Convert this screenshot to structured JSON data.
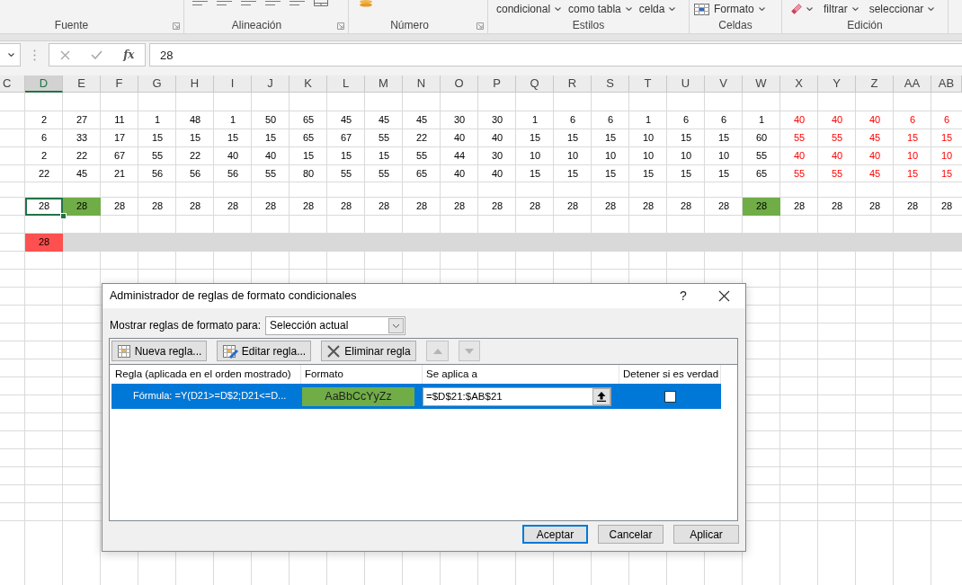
{
  "ribbon": {
    "groups": [
      {
        "kind": "font",
        "label": "Fuente"
      },
      {
        "kind": "alignment",
        "label": "Alineación"
      },
      {
        "kind": "number",
        "label": "Número"
      },
      {
        "kind": "styles",
        "label": "Estilos",
        "items": [
          {
            "label": "condicional"
          },
          {
            "label": "como tabla"
          },
          {
            "label": "celda"
          }
        ]
      },
      {
        "kind": "cells",
        "label": "Celdas",
        "items": [
          {
            "label": "Formato"
          }
        ]
      },
      {
        "kind": "editing",
        "label": "Edición",
        "items": [
          {
            "label": "filtrar"
          },
          {
            "label": "seleccionar"
          }
        ]
      }
    ]
  },
  "formula_bar": {
    "function_label": "fx",
    "value": "28"
  },
  "sheet": {
    "columns": [
      {
        "label": "C",
        "selected": false
      },
      {
        "label": "D",
        "selected": true
      },
      {
        "label": "E",
        "selected": false
      },
      {
        "label": "F",
        "selected": false
      },
      {
        "label": "G",
        "selected": false
      },
      {
        "label": "H",
        "selected": false
      },
      {
        "label": "I",
        "selected": false
      },
      {
        "label": "J",
        "selected": false
      },
      {
        "label": "K",
        "selected": false
      },
      {
        "label": "L",
        "selected": false
      },
      {
        "label": "M",
        "selected": false
      },
      {
        "label": "N",
        "selected": false
      },
      {
        "label": "O",
        "selected": false
      },
      {
        "label": "P",
        "selected": false
      },
      {
        "label": "Q",
        "selected": false
      },
      {
        "label": "R",
        "selected": false
      },
      {
        "label": "S",
        "selected": false
      },
      {
        "label": "T",
        "selected": false
      },
      {
        "label": "U",
        "selected": false
      },
      {
        "label": "V",
        "selected": false
      },
      {
        "label": "W",
        "selected": false
      },
      {
        "label": "X",
        "selected": false
      },
      {
        "label": "Y",
        "selected": false
      },
      {
        "label": "Z",
        "selected": false
      },
      {
        "label": "AA",
        "selected": false
      },
      {
        "label": "AB",
        "selected": false
      }
    ],
    "data_rows": [
      [
        {
          "value": "2",
          "flagged": false
        },
        {
          "value": "27",
          "flagged": false
        },
        {
          "value": "11",
          "flagged": false
        },
        {
          "value": "1",
          "flagged": false
        },
        {
          "value": "48",
          "flagged": false
        },
        {
          "value": "1",
          "flagged": false
        },
        {
          "value": "50",
          "flagged": false
        },
        {
          "value": "65",
          "flagged": false
        },
        {
          "value": "45",
          "flagged": false
        },
        {
          "value": "45",
          "flagged": false
        },
        {
          "value": "45",
          "flagged": false
        },
        {
          "value": "30",
          "flagged": false
        },
        {
          "value": "30",
          "flagged": false
        },
        {
          "value": "1",
          "flagged": false
        },
        {
          "value": "6",
          "flagged": false
        },
        {
          "value": "6",
          "flagged": false
        },
        {
          "value": "1",
          "flagged": false
        },
        {
          "value": "6",
          "flagged": false
        },
        {
          "value": "6",
          "flagged": false
        },
        {
          "value": "1",
          "flagged": false
        },
        {
          "value": "40",
          "flagged": true
        },
        {
          "value": "40",
          "flagged": true
        },
        {
          "value": "40",
          "flagged": true
        },
        {
          "value": "6",
          "flagged": true
        },
        {
          "value": "6",
          "flagged": true
        }
      ],
      [
        {
          "value": "6",
          "flagged": false
        },
        {
          "value": "33",
          "flagged": false
        },
        {
          "value": "17",
          "flagged": false
        },
        {
          "value": "15",
          "flagged": false
        },
        {
          "value": "15",
          "flagged": false
        },
        {
          "value": "15",
          "flagged": false
        },
        {
          "value": "15",
          "flagged": false
        },
        {
          "value": "65",
          "flagged": false
        },
        {
          "value": "67",
          "flagged": false
        },
        {
          "value": "55",
          "flagged": false
        },
        {
          "value": "22",
          "flagged": false
        },
        {
          "value": "40",
          "flagged": false
        },
        {
          "value": "40",
          "flagged": false
        },
        {
          "value": "15",
          "flagged": false
        },
        {
          "value": "15",
          "flagged": false
        },
        {
          "value": "15",
          "flagged": false
        },
        {
          "value": "10",
          "flagged": false
        },
        {
          "value": "15",
          "flagged": false
        },
        {
          "value": "15",
          "flagged": false
        },
        {
          "value": "60",
          "flagged": false
        },
        {
          "value": "55",
          "flagged": true
        },
        {
          "value": "55",
          "flagged": true
        },
        {
          "value": "45",
          "flagged": true
        },
        {
          "value": "15",
          "flagged": true
        },
        {
          "value": "15",
          "flagged": true
        }
      ],
      [
        {
          "value": "2",
          "flagged": false
        },
        {
          "value": "22",
          "flagged": false
        },
        {
          "value": "67",
          "flagged": false
        },
        {
          "value": "55",
          "flagged": false
        },
        {
          "value": "22",
          "flagged": false
        },
        {
          "value": "40",
          "flagged": false
        },
        {
          "value": "40",
          "flagged": false
        },
        {
          "value": "15",
          "flagged": false
        },
        {
          "value": "15",
          "flagged": false
        },
        {
          "value": "15",
          "flagged": false
        },
        {
          "value": "55",
          "flagged": false
        },
        {
          "value": "44",
          "flagged": false
        },
        {
          "value": "30",
          "flagged": false
        },
        {
          "value": "10",
          "flagged": false
        },
        {
          "value": "10",
          "flagged": false
        },
        {
          "value": "10",
          "flagged": false
        },
        {
          "value": "10",
          "flagged": false
        },
        {
          "value": "10",
          "flagged": false
        },
        {
          "value": "10",
          "flagged": false
        },
        {
          "value": "55",
          "flagged": false
        },
        {
          "value": "40",
          "flagged": true
        },
        {
          "value": "40",
          "flagged": true
        },
        {
          "value": "40",
          "flagged": true
        },
        {
          "value": "10",
          "flagged": true
        },
        {
          "value": "10",
          "flagged": true
        }
      ],
      [
        {
          "value": "22",
          "flagged": false
        },
        {
          "value": "45",
          "flagged": false
        },
        {
          "value": "21",
          "flagged": false
        },
        {
          "value": "56",
          "flagged": false
        },
        {
          "value": "56",
          "flagged": false
        },
        {
          "value": "56",
          "flagged": false
        },
        {
          "value": "55",
          "flagged": false
        },
        {
          "value": "80",
          "flagged": false
        },
        {
          "value": "55",
          "flagged": false
        },
        {
          "value": "55",
          "flagged": false
        },
        {
          "value": "65",
          "flagged": false
        },
        {
          "value": "40",
          "flagged": false
        },
        {
          "value": "40",
          "flagged": false
        },
        {
          "value": "15",
          "flagged": false
        },
        {
          "value": "15",
          "flagged": false
        },
        {
          "value": "15",
          "flagged": false
        },
        {
          "value": "15",
          "flagged": false
        },
        {
          "value": "15",
          "flagged": false
        },
        {
          "value": "15",
          "flagged": false
        },
        {
          "value": "65",
          "flagged": false
        },
        {
          "value": "55",
          "flagged": true
        },
        {
          "value": "55",
          "flagged": true
        },
        {
          "value": "45",
          "flagged": true
        },
        {
          "value": "15",
          "flagged": true
        },
        {
          "value": "15",
          "flagged": true
        }
      ]
    ],
    "check_row": [
      {
        "value": "28",
        "selected": true,
        "highlighted": false
      },
      {
        "value": "28",
        "selected": false,
        "highlighted": true
      },
      {
        "value": "28",
        "selected": false,
        "highlighted": false
      },
      {
        "value": "28",
        "selected": false,
        "highlighted": false
      },
      {
        "value": "28",
        "selected": false,
        "highlighted": false
      },
      {
        "value": "28",
        "selected": false,
        "highlighted": false
      },
      {
        "value": "28",
        "selected": false,
        "highlighted": false
      },
      {
        "value": "28",
        "selected": false,
        "highlighted": false
      },
      {
        "value": "28",
        "selected": false,
        "highlighted": false
      },
      {
        "value": "28",
        "selected": false,
        "highlighted": false
      },
      {
        "value": "28",
        "selected": false,
        "highlighted": false
      },
      {
        "value": "28",
        "selected": false,
        "highlighted": false
      },
      {
        "value": "28",
        "selected": false,
        "highlighted": false
      },
      {
        "value": "28",
        "selected": false,
        "highlighted": false
      },
      {
        "value": "28",
        "selected": false,
        "highlighted": false
      },
      {
        "value": "28",
        "selected": false,
        "highlighted": false
      },
      {
        "value": "28",
        "selected": false,
        "highlighted": false
      },
      {
        "value": "28",
        "selected": false,
        "highlighted": false
      },
      {
        "value": "28",
        "selected": false,
        "highlighted": false
      },
      {
        "value": "28",
        "selected": false,
        "highlighted": true
      },
      {
        "value": "28",
        "selected": false,
        "highlighted": false
      },
      {
        "value": "28",
        "selected": false,
        "highlighted": false
      },
      {
        "value": "28",
        "selected": false,
        "highlighted": false
      },
      {
        "value": "28",
        "selected": false,
        "highlighted": false
      },
      {
        "value": "28",
        "selected": false,
        "highlighted": false
      }
    ],
    "result_cell": {
      "value": "28"
    }
  },
  "dialog": {
    "title": "Administrador de reglas de formato condicionales",
    "help": "?",
    "scope_label": "Mostrar reglas de formato para:",
    "scope_value": "Selección actual",
    "toolbar": [
      {
        "kind": "new",
        "label": "Nueva regla...",
        "disabled": false
      },
      {
        "kind": "edit",
        "label": "Editar regla...",
        "disabled": false
      },
      {
        "kind": "delete",
        "label": "Eliminar regla",
        "disabled": false
      },
      {
        "kind": "up",
        "disabled": true
      },
      {
        "kind": "down",
        "disabled": true
      }
    ],
    "columns": [
      "Regla (aplicada en el orden mostrado)",
      "Formato",
      "Se aplica a",
      "Detener si es verdad"
    ],
    "rules": [
      {
        "rule": "Fórmula: =Y(D21>=D$2;D21<=D...",
        "preview": "AaBbCcYyZz",
        "color": "#70ad47",
        "applies_to": "=$D$21:$AB$21",
        "stop_if_true": false,
        "selected": true
      }
    ],
    "buttons": [
      {
        "label": "Aceptar",
        "default": true
      },
      {
        "label": "Cancelar",
        "default": false
      },
      {
        "label": "Aplicar",
        "default": false
      }
    ]
  }
}
